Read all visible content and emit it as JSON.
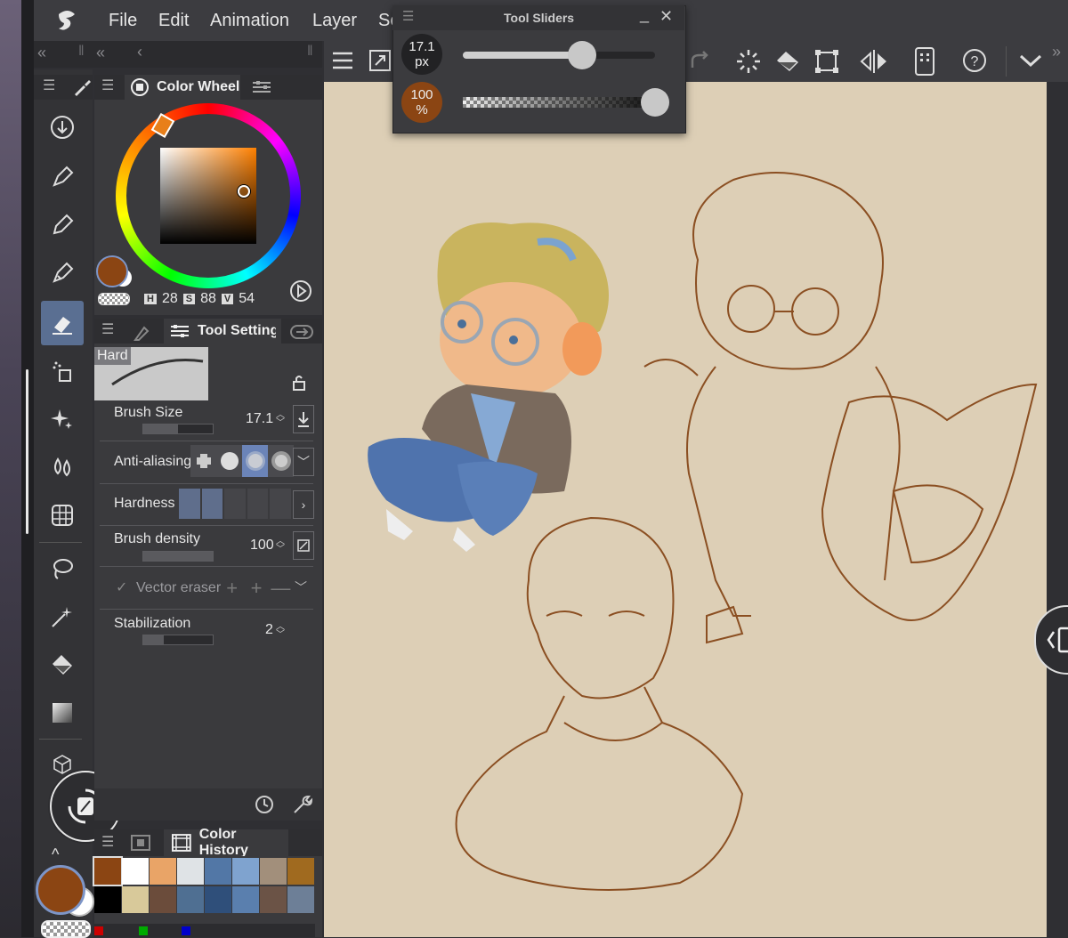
{
  "menu": {
    "items": [
      "File",
      "Edit",
      "Animation",
      "Layer",
      "Se"
    ]
  },
  "tool_sliders": {
    "title": "Tool Sliders",
    "size_value": "17.1",
    "size_unit": "px",
    "size_level": 0.62,
    "opacity_value": "100",
    "opacity_unit": "%",
    "opacity_level": 1.0
  },
  "color_wheel": {
    "title": "Color Wheel",
    "h_label": "H",
    "h_value": "28",
    "s_label": "S",
    "s_value": "88",
    "v_label": "V",
    "v_value": "54",
    "main_color": "#8b4513"
  },
  "tool_setting": {
    "title": "Tool Setting",
    "preset_name": "Hard",
    "brush_size_label": "Brush Size",
    "brush_size_value": "17.1",
    "anti_aliasing_label": "Anti-aliasing",
    "hardness_label": "Hardness",
    "brush_density_label": "Brush density",
    "brush_density_value": "100",
    "vector_eraser_label": "Vector eraser",
    "stabilization_label": "Stabilization",
    "stabilization_value": "2"
  },
  "color_history": {
    "title": "Color History",
    "swatches": [
      "#8b4513",
      "#ffffff",
      "#e9a467",
      "#dfe3e6",
      "#5277a6",
      "#7fa3cf",
      "#a28f7b",
      "#a06a1f",
      "#000000",
      "#d8c99a",
      "#6b4c3b",
      "#4f6f92",
      "#2f4f7a",
      "#5a7fae",
      "#6b5346",
      "#6d7f97"
    ]
  },
  "colors": {
    "accent": "#5a6f92",
    "canvas": "#ddcfb6",
    "sketch": "#8b4f22"
  }
}
